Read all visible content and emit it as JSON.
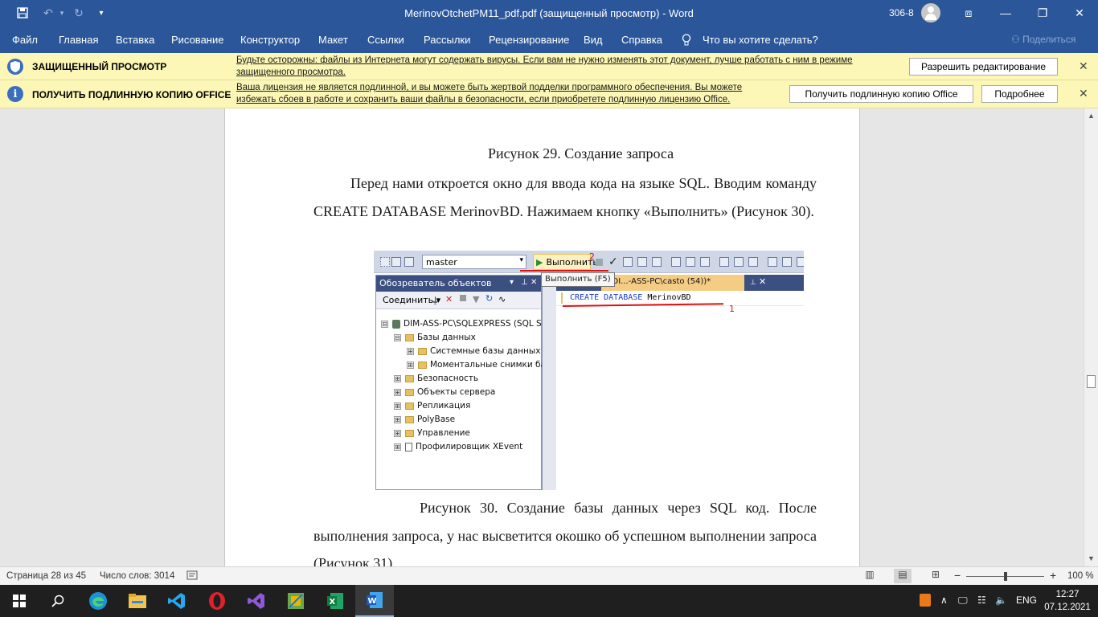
{
  "window": {
    "title": "MerinovOtchetPM11_pdf.pdf (защищенный просмотр)  -  Word",
    "user": "306-8",
    "buttons": {
      "ribbon_display": "⧈",
      "minimize": "—",
      "restore": "❐",
      "close": "✕"
    },
    "quick_access": [
      "save-icon",
      "undo-icon",
      "redo-icon",
      "customize-icon"
    ]
  },
  "ribbon": {
    "tabs": [
      "Файл",
      "Главная",
      "Вставка",
      "Рисование",
      "Конструктор",
      "Макет",
      "Ссылки",
      "Рассылки",
      "Рецензирование",
      "Вид",
      "Справка"
    ],
    "tell_me": "Что вы хотите сделать?",
    "share": "Поделиться"
  },
  "protected_bar": {
    "heading": "ЗАЩИЩЕННЫЙ ПРОСМОТР",
    "message": "Будьте осторожны: файлы из Интернета могут содержать вирусы. Если вам не нужно изменять этот документ, лучше работать с ним в режиме защищенного просмотра.",
    "button": "Разрешить редактирование"
  },
  "license_bar": {
    "heading": "ПОЛУЧИТЬ ПОДЛИННУЮ КОПИЮ OFFICE",
    "message": "Ваша лицензия не является подлинной, и вы можете быть жертвой подделки программного обеспечения. Вы можете избежать сбоев в работе и сохранить ваши файлы в безопасности, если приобретете подлинную лицензию Office.",
    "button_get": "Получить подлинную копию Office",
    "button_more": "Подробнее"
  },
  "document": {
    "caption_29": "Рисунок 29. Создание запроса",
    "paragraph_1": "Перед нами откроется окно для ввода кода на языке SQL. Вводим команду CREATE DATABASE MerinovBD. Нажимаем кнопку «Выполнить» (Рисунок 30).",
    "paragraph_2": "Рисунок 30. Создание базы данных через SQL код. После выполнения запроса, у нас высветится окошко об успешном выполнении запроса (Рисунок 31)."
  },
  "ssms": {
    "database": "master",
    "execute_label": "Выполнить",
    "execute_tooltip": "Выполнить (F5)",
    "mark_execute": "2",
    "mark_code": "1",
    "object_explorer": {
      "title": "Обозреватель объектов",
      "connect": "Соединить",
      "nodes": [
        {
          "label": "DIM-ASS-PC\\SQLEXPRESS (SQL Server",
          "level": 0,
          "toggle": "⊟",
          "icon": "server-icon"
        },
        {
          "label": "Базы данных",
          "level": 1,
          "toggle": "⊟",
          "icon": "folder-icon"
        },
        {
          "label": "Системные базы данных",
          "level": 2,
          "toggle": "⊞",
          "icon": "folder-icon"
        },
        {
          "label": "Моментальные снимки базы д",
          "level": 2,
          "toggle": "⊞",
          "icon": "folder-icon"
        },
        {
          "label": "Безопасность",
          "level": 1,
          "toggle": "⊞",
          "icon": "folder-icon"
        },
        {
          "label": "Объекты сервера",
          "level": 1,
          "toggle": "⊞",
          "icon": "folder-icon"
        },
        {
          "label": "Репликация",
          "level": 1,
          "toggle": "⊞",
          "icon": "folder-icon"
        },
        {
          "label": "PolyBase",
          "level": 1,
          "toggle": "⊞",
          "icon": "folder-icon"
        },
        {
          "label": "Управление",
          "level": 1,
          "toggle": "⊞",
          "icon": "folder-icon"
        },
        {
          "label": "Профилировщик XEvent",
          "level": 1,
          "toggle": "⊞",
          "icon": "xevent-icon"
        }
      ]
    },
    "query_tab": "...DI...-ASS-PC\\casto (54))*",
    "code_keywords": "CREATE DATABASE",
    "code_name": "MerinovBD"
  },
  "statusbar": {
    "page": "Страница 28 из 45",
    "words": "Число слов: 3014",
    "zoom": "100 %",
    "zoom_minus": "−",
    "zoom_plus": "+"
  },
  "taskbar": {
    "lang": "ENG",
    "time": "12:27",
    "date": "07.12.2021",
    "apps": [
      "windows-start-icon",
      "search-icon",
      "edge-icon",
      "file-explorer-icon",
      "vscode-icon",
      "opera-icon",
      "visual-studio-icon",
      "game-app-icon",
      "excel-icon",
      "word-icon"
    ]
  },
  "colors": {
    "word_blue": "#2b579a",
    "info_bar": "#fcf7b6",
    "ssms_header": "#3b4f81",
    "annotation_red": "#dd1111"
  }
}
